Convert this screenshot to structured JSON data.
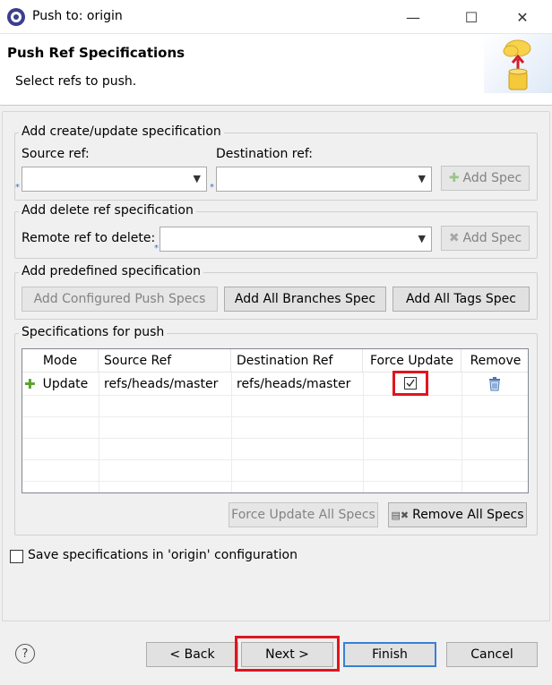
{
  "window": {
    "title": "Push to: origin",
    "minimize": "—",
    "maximize": "☐",
    "close": "✕"
  },
  "header": {
    "title": "Push Ref Specifications",
    "subtitle": "Select refs to push."
  },
  "create_group": {
    "legend": "Add create/update specification",
    "source_label": "Source ref:",
    "destination_label": "Destination ref:",
    "source_value": "",
    "destination_value": "",
    "add_spec": "Add Spec"
  },
  "delete_group": {
    "legend": "Add delete ref specification",
    "remote_label": "Remote ref to delete:",
    "remote_value": "",
    "add_spec": "Add Spec"
  },
  "predefined_group": {
    "legend": "Add predefined specification",
    "configured": "Add Configured Push Specs",
    "all_branches": "Add All Branches Spec",
    "all_tags": "Add All Tags Spec"
  },
  "specs_group": {
    "legend": "Specifications for push",
    "columns": [
      "Mode",
      "Source Ref",
      "Destination Ref",
      "Force Update",
      "Remove"
    ],
    "rows": [
      {
        "mode": "Update",
        "source": "refs/heads/master",
        "destination": "refs/heads/master",
        "force_update": true
      }
    ],
    "force_update_all": "Force Update All Specs",
    "remove_all": "Remove All Specs"
  },
  "save_config": {
    "label": "Save specifications in 'origin' configuration",
    "checked": false
  },
  "footer": {
    "help": "?",
    "back": "< Back",
    "next": "Next >",
    "finish": "Finish",
    "cancel": "Cancel"
  },
  "colors": {
    "highlight": "#e0151f",
    "primary_border": "#3b7fd6",
    "add_icon": "#5aa02c",
    "remove_icon": "#4a78b8"
  },
  "icons": [
    "eclipse-app-icon",
    "push-cloud-icon",
    "add-icon",
    "remove-icon",
    "trash-icon",
    "remove-all-icon",
    "help-icon"
  ]
}
